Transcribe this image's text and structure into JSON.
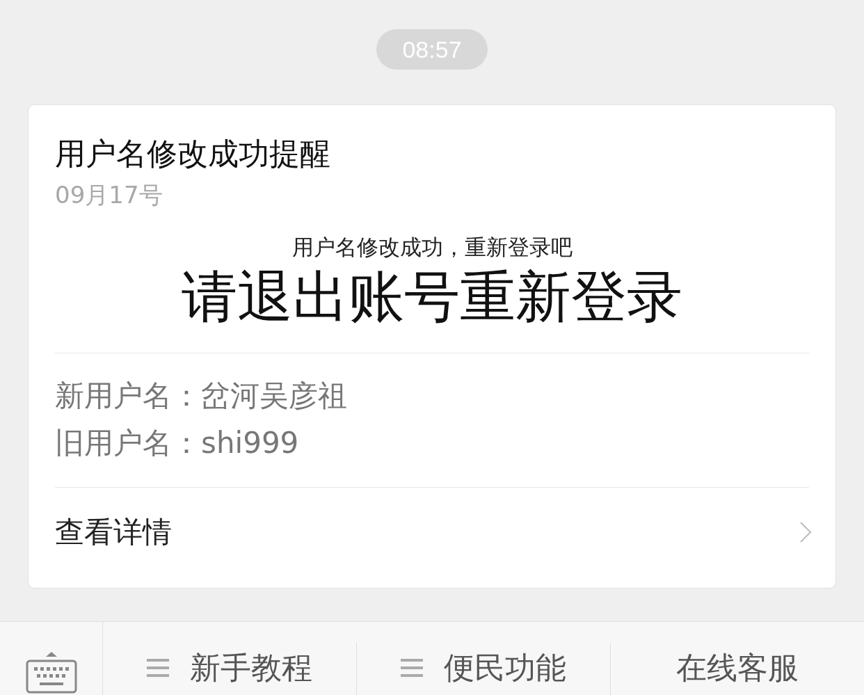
{
  "time": "08:57",
  "card": {
    "title": "用户名修改成功提醒",
    "date": "09月17号",
    "subtitle": "用户名修改成功，重新登录吧",
    "headline": "请退出账号重新登录",
    "fields": [
      {
        "label": "新用户名：",
        "value": "岔河吴彦祖"
      },
      {
        "label": "旧用户名：",
        "value": "shi999"
      }
    ],
    "link": "查看详情"
  },
  "menu_bar": {
    "items": [
      {
        "label": "新手教程",
        "kind": "submenu"
      },
      {
        "label": "便民功能",
        "kind": "submenu"
      },
      {
        "label": "在线客服",
        "kind": "plain"
      }
    ]
  }
}
